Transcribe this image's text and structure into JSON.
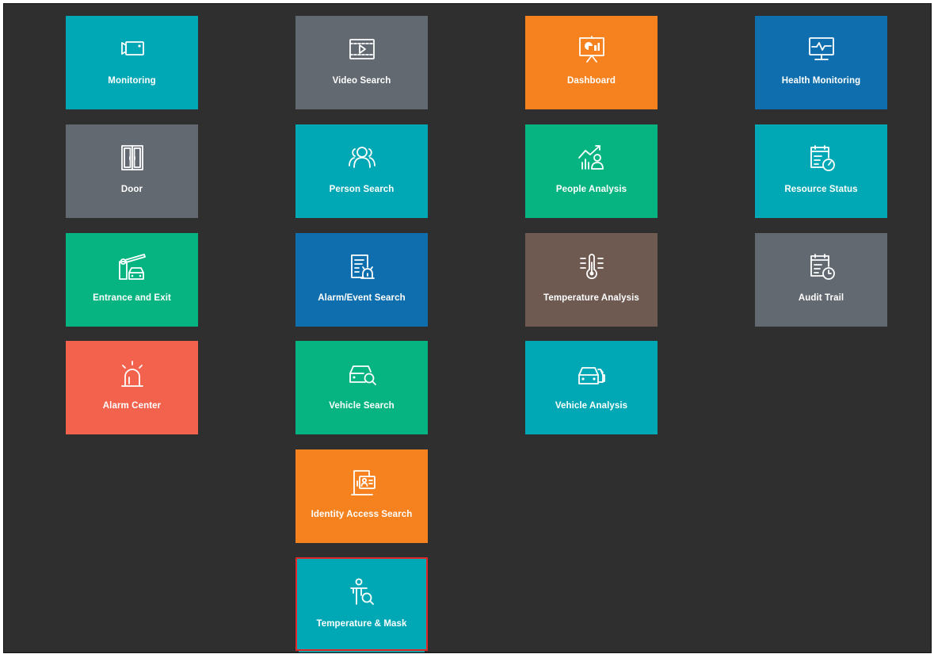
{
  "tiles": [
    {
      "label": "Monitoring",
      "icon": "camera-icon"
    },
    {
      "label": "Video Search",
      "icon": "video-player-icon"
    },
    {
      "label": "Dashboard",
      "icon": "presentation-chart-icon"
    },
    {
      "label": "Health Monitoring",
      "icon": "heartbeat-monitor-icon"
    },
    {
      "label": "Door",
      "icon": "double-door-icon"
    },
    {
      "label": "Person Search",
      "icon": "group-people-icon"
    },
    {
      "label": "People Analysis",
      "icon": "people-trend-icon"
    },
    {
      "label": "Resource Status",
      "icon": "clipboard-gauge-icon"
    },
    {
      "label": "Entrance and Exit",
      "icon": "barrier-gate-car-icon"
    },
    {
      "label": "Alarm/Event Search",
      "icon": "document-alarm-icon"
    },
    {
      "label": "Temperature Analysis",
      "icon": "thermometer-icon"
    },
    {
      "label": "Audit Trail",
      "icon": "clipboard-clock-icon"
    },
    {
      "label": "Alarm Center",
      "icon": "alarm-siren-icon"
    },
    {
      "label": "Vehicle Search",
      "icon": "car-search-icon"
    },
    {
      "label": "Vehicle Analysis",
      "icon": "cars-icon"
    },
    {
      "label": "Identity Access Search",
      "icon": "door-id-card-icon"
    },
    {
      "label": "Temperature & Mask",
      "icon": "person-scan-icon"
    }
  ],
  "colors": {
    "background": "#2f2f2f",
    "teal": "#00a8b5",
    "grey": "#626970",
    "orange": "#f5821f",
    "blue": "#0f6fae",
    "green": "#06b481",
    "brown": "#6f5a51",
    "red": "#f2624d",
    "selected_border": "#e02828"
  },
  "selected_tile": "Temperature & Mask"
}
